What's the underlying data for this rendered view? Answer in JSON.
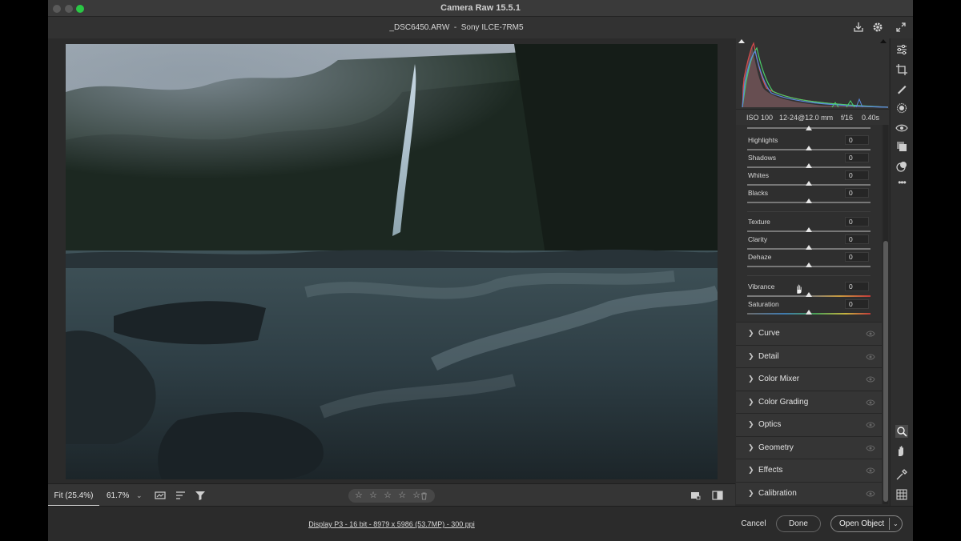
{
  "window": {
    "title": "Camera Raw 15.5.1"
  },
  "file": {
    "name": "_DSC6450.ARW",
    "separator": "-",
    "camera": "Sony ILCE-7RM5"
  },
  "exif": {
    "iso": "ISO 100",
    "lens": "12-24@12.0 mm",
    "aperture": "f/16",
    "shutter": "0.40s"
  },
  "sliders": [
    {
      "label": "Highlights",
      "value": "0"
    },
    {
      "label": "Shadows",
      "value": "0"
    },
    {
      "label": "Whites",
      "value": "0"
    },
    {
      "label": "Blacks",
      "value": "0"
    },
    {
      "label": "Texture",
      "value": "0"
    },
    {
      "label": "Clarity",
      "value": "0"
    },
    {
      "label": "Dehaze",
      "value": "0"
    },
    {
      "label": "Vibrance",
      "value": "0"
    },
    {
      "label": "Saturation",
      "value": "0"
    }
  ],
  "sections": [
    {
      "label": "Curve"
    },
    {
      "label": "Detail"
    },
    {
      "label": "Color Mixer"
    },
    {
      "label": "Color Grading"
    },
    {
      "label": "Optics"
    },
    {
      "label": "Geometry"
    },
    {
      "label": "Effects"
    },
    {
      "label": "Calibration"
    }
  ],
  "zoom": {
    "fit_label": "Fit (25.4%)",
    "percent": "61.7%"
  },
  "rating": {
    "stars": [
      "☆",
      "☆",
      "☆",
      "☆",
      "☆"
    ],
    "trash_icon": "trash-icon"
  },
  "footer": {
    "display_info": "Display P3 - 16 bit - 8979 x 5986 (53.7MP) - 300 ppi",
    "cancel_label": "Cancel",
    "done_label": "Done",
    "open_label": "Open Object"
  },
  "icons": {
    "top": [
      "save-icon",
      "gear-icon",
      "fullscreen-icon"
    ],
    "tools": [
      "edit-icon",
      "crop-icon",
      "healing-icon",
      "masking-icon",
      "red-eye-icon",
      "snapshots-icon",
      "presets-icon",
      "more-icon",
      "zoom-icon",
      "hand-icon",
      "sampler-icon",
      "grid-icon"
    ]
  },
  "colors": {
    "accent_green": "#2ac845",
    "panel_bg": "#2b2b2b",
    "section_bg": "#353535"
  }
}
